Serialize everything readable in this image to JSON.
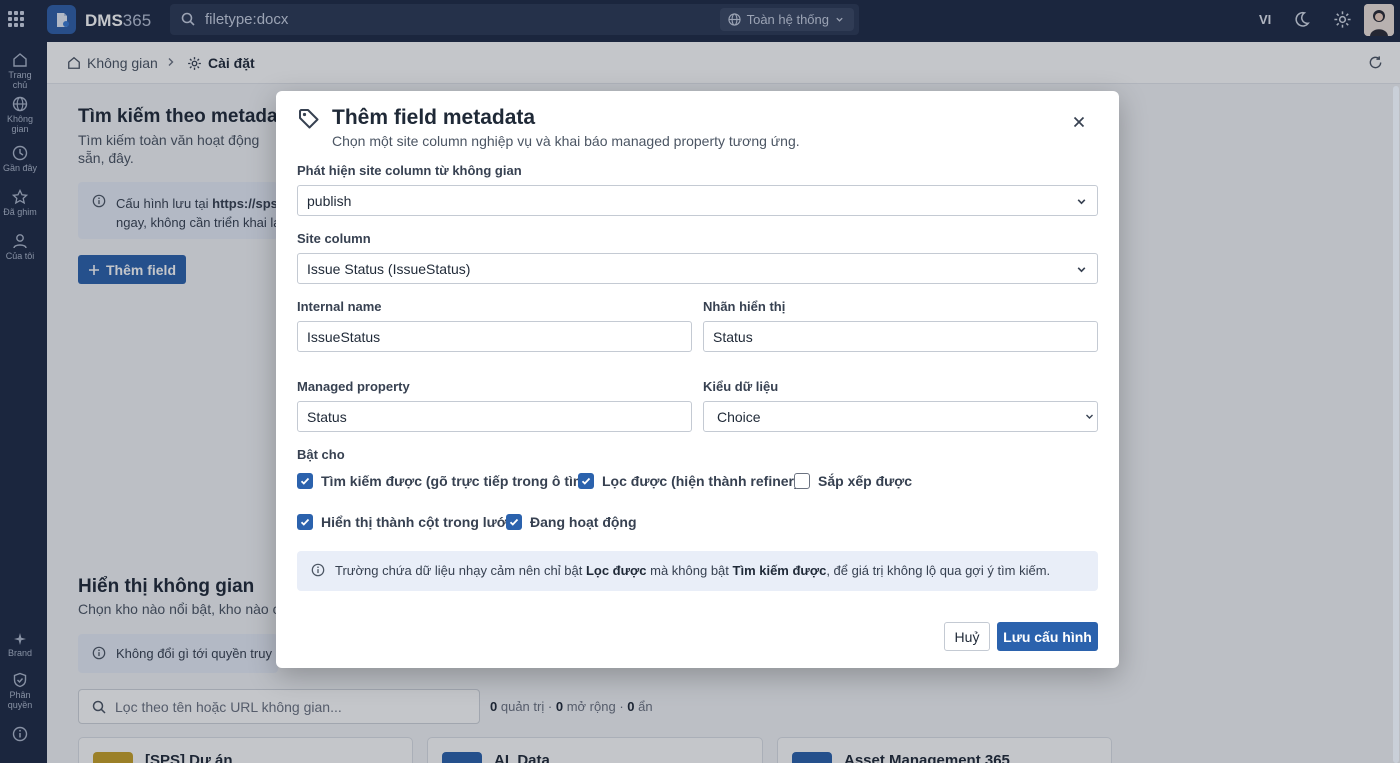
{
  "topbar": {
    "brand_main": "DMS",
    "brand_suffix": "365",
    "search_value": "filetype:docx",
    "scope_label": "Toàn hệ thống",
    "language": "VI"
  },
  "rail": {
    "items": [
      "Trang chủ",
      "Không gian",
      "Gần đây",
      "Đã ghim",
      "Của tôi"
    ],
    "bottom_items": [
      "Brand",
      "Phân quyền"
    ]
  },
  "breadcrumb": {
    "root": "Không gian",
    "current": "Cài đặt"
  },
  "background": {
    "section1_title": "Tìm kiếm theo metadata",
    "section1_desc": "Tìm kiếm toàn văn hoạt động sẵn, đây.",
    "info1_line1_prefix": "Cấu hình lưu tại ",
    "info1_line1_link": "https://spsv",
    "info1_line2": "ngay, không cần triển khai lại",
    "add_field_button": "Thêm field",
    "section2_title": "Hiển thị không gian",
    "section2_desc": "Chọn kho nào nổi bật, kho nào chỉ",
    "info2": "Không đổi gì tới quyền truy c",
    "filter_placeholder": "Lọc theo tên hoặc URL không gian...",
    "stats": {
      "admin_count": "0",
      "admin_label": "quản trị",
      "expanded_count": "0",
      "expanded_label": "mở rộng",
      "hidden_count": "0",
      "hidden_label": "ẩn",
      "separator": "·"
    },
    "cards": [
      "[SPS] Dự án",
      "AI_Data",
      "Asset Management 365"
    ]
  },
  "dialog": {
    "title": "Thêm field metadata",
    "subtitle": "Chọn một site column nghiệp vụ và khai báo managed property tương ứng.",
    "discover_label": "Phát hiện site column từ không gian",
    "discover_value": "publish",
    "site_column_label": "Site column",
    "site_column_value": "Issue Status (IssueStatus)",
    "internal_name_label": "Internal name",
    "internal_name_value": "IssueStatus",
    "display_label_label": "Nhãn hiển thị",
    "display_label_value": "Status",
    "managed_property_label": "Managed property",
    "managed_property_value": "Status",
    "data_type_label": "Kiểu dữ liệu",
    "data_type_value": "Choice",
    "enable_label": "Bật cho",
    "checkboxes": [
      {
        "label": "Tìm kiếm được (gõ trực tiếp trong ô tìm)",
        "checked": true
      },
      {
        "label": "Lọc được (hiện thành refiner)",
        "checked": true
      },
      {
        "label": "Sắp xếp được",
        "checked": false
      },
      {
        "label": "Hiển thị thành cột trong lưới",
        "checked": true
      },
      {
        "label": "Đang hoạt động",
        "checked": true
      }
    ],
    "note": {
      "part1": "Trường chứa dữ liệu nhạy cảm nên chỉ bật ",
      "bold1": "Lọc được",
      "part2": " mà không bật ",
      "bold2": "Tìm kiếm được",
      "part3": ", để giá trị không lộ qua gợi ý tìm kiếm."
    },
    "cancel_button": "Huỷ",
    "save_button": "Lưu cấu hình"
  },
  "colors": {
    "primary": "#2b62ad",
    "rail_bg": "#1e2a44",
    "info_bg": "#e9eef8"
  }
}
